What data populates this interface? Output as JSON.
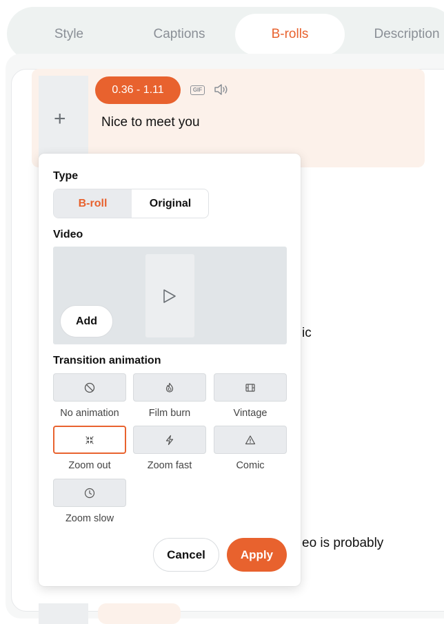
{
  "tabs": [
    {
      "label": "Style"
    },
    {
      "label": "Captions"
    },
    {
      "label": "B-rolls",
      "active": true
    },
    {
      "label": "Description"
    }
  ],
  "segment": {
    "time_start": "0.36",
    "time_sep": "-",
    "time_end": "1.11",
    "time_text": "0.36  -  1.11",
    "gif_label": "GIF",
    "text": "Nice to meet you"
  },
  "background_text": {
    "fragment1": "ic",
    "fragment2": "eo is probably"
  },
  "popup": {
    "type_label": "Type",
    "type_options": [
      "B-roll",
      "Original"
    ],
    "type_selected": "B-roll",
    "video_label": "Video",
    "add_label": "Add",
    "transition_label": "Transition animation",
    "animations": [
      {
        "label": "No animation",
        "icon": "no-animation-icon"
      },
      {
        "label": "Film burn",
        "icon": "film-burn-icon"
      },
      {
        "label": "Vintage",
        "icon": "film-strip-icon"
      },
      {
        "label": "Zoom out",
        "icon": "zoom-out-icon",
        "selected": true
      },
      {
        "label": "Zoom fast",
        "icon": "lightning-icon"
      },
      {
        "label": "Comic",
        "icon": "warning-icon"
      },
      {
        "label": "Zoom slow",
        "icon": "clock-icon"
      }
    ],
    "cancel_label": "Cancel",
    "apply_label": "Apply"
  },
  "colors": {
    "accent": "#e8622e",
    "segment_bg": "#fcf1ea",
    "tab_bar_bg": "#eef2f1"
  }
}
